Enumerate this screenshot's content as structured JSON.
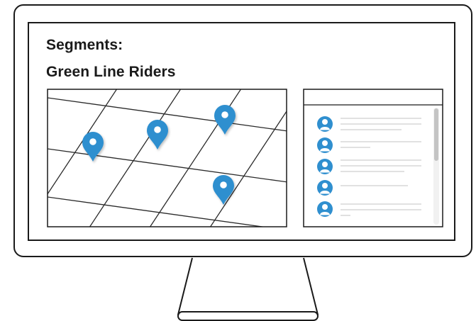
{
  "page": {
    "title_line_1": "Segments:",
    "title_line_2": "Green Line Riders"
  },
  "colors": {
    "outline": "#1a1a1a",
    "pin": "#2f8fcf",
    "avatar": "#2f8fcf",
    "list_line": "#cfcfcf",
    "background": "#ffffff"
  },
  "map": {
    "icon": "map-pin-icon",
    "pin_count": 4
  },
  "contact_list": {
    "icon": "user-avatar-icon",
    "item_count": 5
  }
}
